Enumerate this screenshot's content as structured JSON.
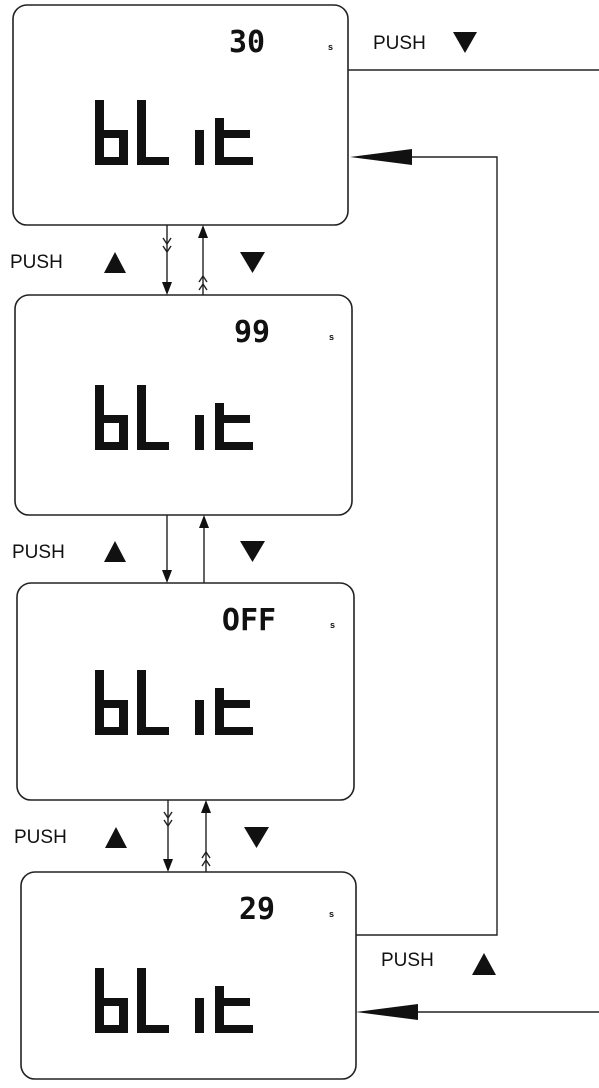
{
  "screens": [
    {
      "value": "30",
      "unit": "s",
      "text": "bL iE"
    },
    {
      "value": "99",
      "unit": "s",
      "text": "bL iE"
    },
    {
      "value": "OFF",
      "unit": "s",
      "text": "bL iE"
    },
    {
      "value": "29",
      "unit": "s",
      "text": "bL iE"
    }
  ],
  "labels": {
    "push": "PUSH",
    "up_symbol": "▲",
    "down_symbol": "▼"
  }
}
